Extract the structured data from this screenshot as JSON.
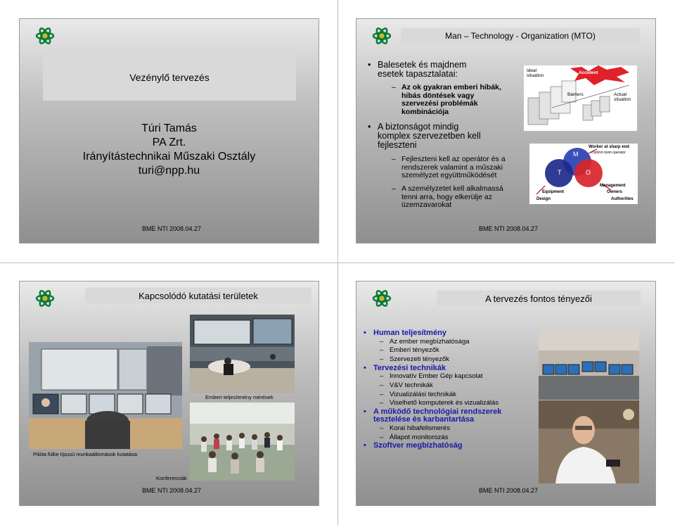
{
  "footer_text": "BME NTI 2008.04.27",
  "slide1": {
    "title": "Vezénylő tervezés",
    "author": "Túri Tamás",
    "company": "PA Zrt.",
    "department": "Irányítástechnikai Műszaki Osztály",
    "email": "turi@npp.hu"
  },
  "slide2": {
    "title": "Man – Technology - Organization (MTO)",
    "bullet1": "Balesetek és majdnem\nesetek tapasztalatai:",
    "sub1": "Az ok gyakran emberi hibák,\nhibás döntések vagy\nszervezési problémák\nkombinációja",
    "bullet2": "A biztonságot mindig\nkomplex szervezetben kell\nfejleszteni",
    "sub2": "Fejleszteni kell az operátor és a\nrendszerek valamint a műszaki\nszemélyzet együttműködését",
    "sub3": "A személyzetet kell alkalmassá\ntenni arra, hogy elkerülje az\nüzemzavarokat",
    "diagram1": {
      "ideal": "Ideal\nsituation",
      "accident": "Accident",
      "barriers": "Barriers",
      "actual": "Actual\nsituation"
    },
    "diagram2": {
      "m": "M",
      "t": "T",
      "o": "O",
      "worker": "Worker at sharp end",
      "control": "Control room operator",
      "equipment": "Equipment",
      "design": "Design",
      "management": "Management",
      "owners": "Owners",
      "authorities": "Authorities"
    }
  },
  "slide3": {
    "title": "Kapcsolódó kutatási területek",
    "caption1": "Pilóta fülke típusú munkaállomások kutatása",
    "caption2": "Emberi teljesítmény mérések",
    "caption3": "Konferenciák"
  },
  "slide4": {
    "title": "A tervezés fontos tényezői",
    "items": [
      {
        "level": 1,
        "text": "Human teljesítmény"
      },
      {
        "level": 2,
        "text": "Az ember megbízhatósága"
      },
      {
        "level": 2,
        "text": "Emberi tényezők"
      },
      {
        "level": 2,
        "text": "Szervezeti tényezők"
      },
      {
        "level": 1,
        "text": "Tervezési technikák"
      },
      {
        "level": 2,
        "text": "Innovatív Ember Gép kapcsolat"
      },
      {
        "level": 2,
        "text": "V&V technikák"
      },
      {
        "level": 2,
        "text": "Vizualizálási technikák"
      },
      {
        "level": 2,
        "text": "Viselhető komputerek és vizualizálás"
      },
      {
        "level": 1,
        "text": "A működő technológiai rendszerek tesztelése és karbantartása"
      },
      {
        "level": 2,
        "text": "Korai hibafelismerés"
      },
      {
        "level": 2,
        "text": "Állapot monitorozás"
      },
      {
        "level": 1,
        "text": "Szoftver megbízhatóság"
      }
    ]
  },
  "colors": {
    "bullet_blue": "#1a1aa6",
    "title_bar": "#d9d9d9",
    "accident_red": "#e0202a",
    "venn_m": "#3b4fb8",
    "venn_t": "#1e2a8a",
    "venn_o": "#d8242a"
  }
}
